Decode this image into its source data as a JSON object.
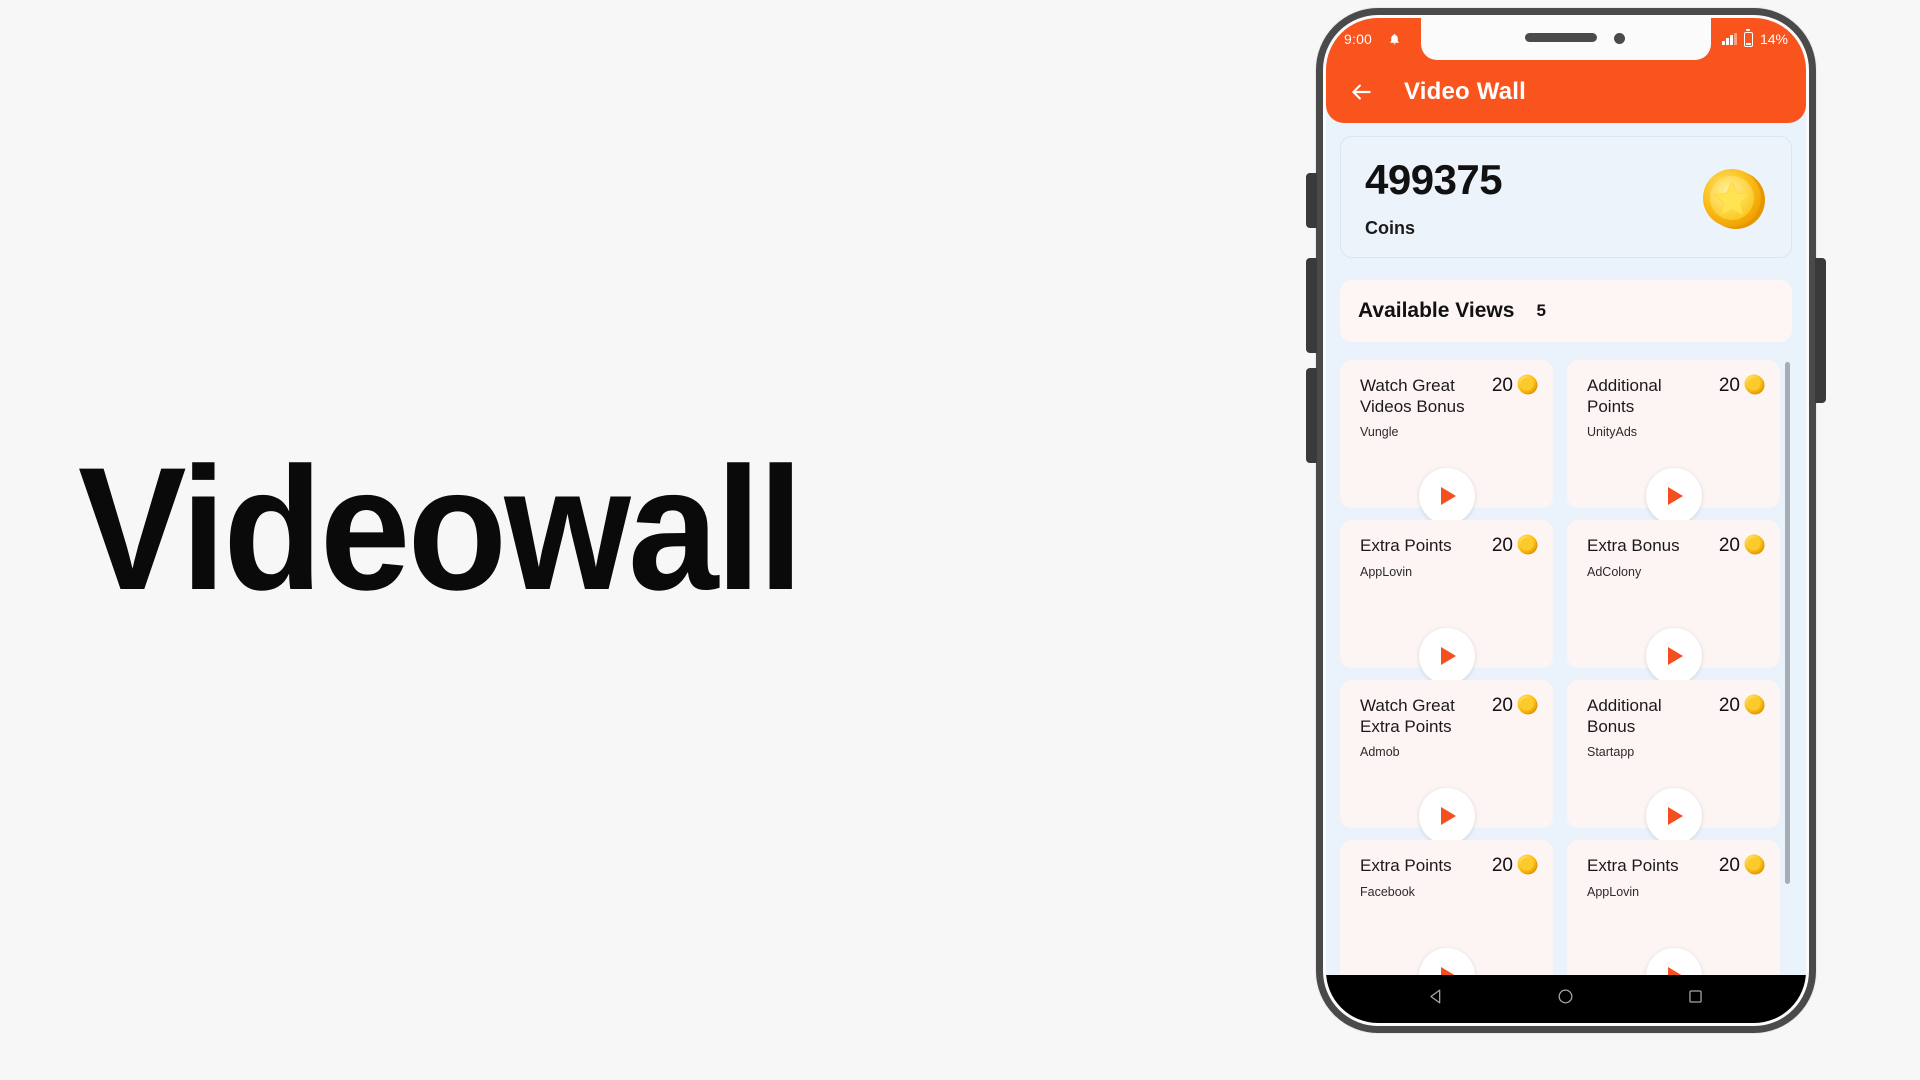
{
  "hero": {
    "word": "Videowall"
  },
  "colors": {
    "accent": "#F9531E",
    "play": "#F4501E",
    "screen_bg": "#EAF2FC",
    "card_bg": "#FDF5F3",
    "coins_card_bg": "#EDF3FB",
    "coin_gold": "#F5C518",
    "nav_bg": "#000000"
  },
  "status_bar": {
    "time": "9:00",
    "bell_icon": "bell-icon",
    "signal_icon": "signal-bars-icon",
    "battery_icon": "battery-icon",
    "battery_percent": "14%"
  },
  "app_bar": {
    "back_icon": "back-arrow-icon",
    "title": "Video Wall"
  },
  "coins_card": {
    "amount": "499375",
    "label": "Coins",
    "coin_icon": "coin-star-icon"
  },
  "available_views": {
    "label": "Available Views",
    "count": "5"
  },
  "video_cards": [
    {
      "title": "Watch Great Videos Bonus",
      "amount": "20",
      "network": "Vungle",
      "coin_icon": "coin-icon",
      "play_icon": "play-icon"
    },
    {
      "title": "Additional Points",
      "amount": "20",
      "network": "UnityAds",
      "coin_icon": "coin-icon",
      "play_icon": "play-icon"
    },
    {
      "title": "Extra Points",
      "amount": "20",
      "network": "AppLovin",
      "coin_icon": "coin-icon",
      "play_icon": "play-icon"
    },
    {
      "title": "Extra Bonus",
      "amount": "20",
      "network": "AdColony",
      "coin_icon": "coin-icon",
      "play_icon": "play-icon"
    },
    {
      "title": "Watch Great Extra Points",
      "amount": "20",
      "network": "Admob",
      "coin_icon": "coin-icon",
      "play_icon": "play-icon"
    },
    {
      "title": "Additional Bonus",
      "amount": "20",
      "network": "Startapp",
      "coin_icon": "coin-icon",
      "play_icon": "play-icon"
    },
    {
      "title": "Extra Points",
      "amount": "20",
      "network": "Facebook",
      "coin_icon": "coin-icon",
      "play_icon": "play-icon"
    },
    {
      "title": "Extra Points",
      "amount": "20",
      "network": "AppLovin",
      "coin_icon": "coin-icon",
      "play_icon": "play-icon"
    }
  ],
  "android_nav": {
    "back_icon": "nav-back-triangle-icon",
    "home_icon": "nav-home-circle-icon",
    "recents_icon": "nav-recents-square-icon"
  },
  "phone_hardware": {
    "speaker_icon": "earpiece-speaker",
    "camera_icon": "front-camera",
    "volume_up_button": "volume-up-button",
    "volume_down_button": "volume-down-button",
    "extra_button": "side-button",
    "power_button": "power-button"
  }
}
